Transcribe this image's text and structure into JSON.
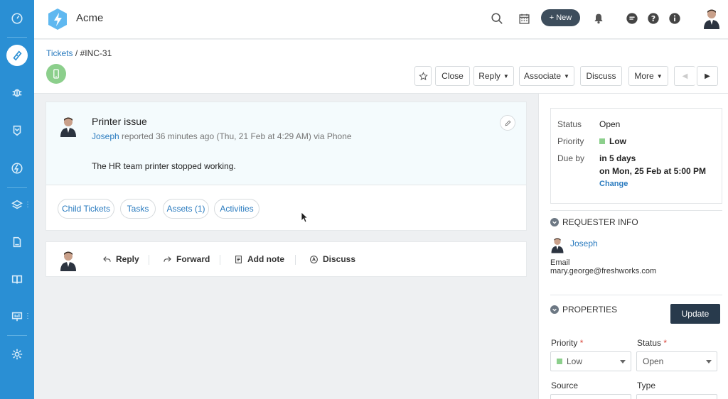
{
  "app": {
    "title": "Acme",
    "new_label": "New"
  },
  "colors": {
    "rail": "#2a8fd4",
    "accent_link": "#2a7bbf",
    "phone_badge": "#8ccf8c",
    "update_button": "#283a4c",
    "priority_low": "#8ccf8c"
  },
  "rail_icons": [
    "dashboard-icon",
    "tickets-icon",
    "problems-icon",
    "changes-icon",
    "releases-icon",
    "assets-icon",
    "contracts-icon",
    "solutions-icon",
    "reports-icon",
    "admin-icon"
  ],
  "header_icons": [
    "search-icon",
    "calendar-icon",
    "plus-icon",
    "bell-icon",
    "chat-icon",
    "help-icon",
    "info-icon",
    "avatar"
  ],
  "breadcrumb": {
    "root": "Tickets",
    "separator": " / ",
    "current": "#INC-31"
  },
  "actions": {
    "close": "Close",
    "reply": "Reply",
    "associate": "Associate",
    "discuss": "Discuss",
    "more": "More"
  },
  "ticket": {
    "title": "Printer issue",
    "requester": "Joseph",
    "meta": " reported 36 minutes ago (Thu, 21 Feb at 4:29 AM) via Phone",
    "body": "The HR team printer stopped working.",
    "tabs": [
      "Child Tickets",
      "Tasks",
      "Assets (1)",
      "Activities"
    ]
  },
  "reply_bar": {
    "reply": "Reply",
    "forward": "Forward",
    "add_note": "Add note",
    "discuss": "Discuss"
  },
  "summary": {
    "status_label": "Status",
    "status_value": "Open",
    "priority_label": "Priority",
    "priority_value": "Low",
    "due_label": "Due by",
    "due_value": "in 5 days",
    "due_date": "on Mon, 25 Feb at 5:00 PM",
    "change_label": "Change"
  },
  "requester_info": {
    "heading": "REQUESTER INFO",
    "name": "Joseph",
    "email_label": "Email",
    "email": "mary.george@freshworks.com"
  },
  "properties": {
    "heading": "PROPERTIES",
    "update_label": "Update",
    "priority_label": "Priority",
    "priority_value": "Low",
    "status_label": "Status",
    "status_value": "Open",
    "source_label": "Source",
    "type_label": "Type"
  }
}
